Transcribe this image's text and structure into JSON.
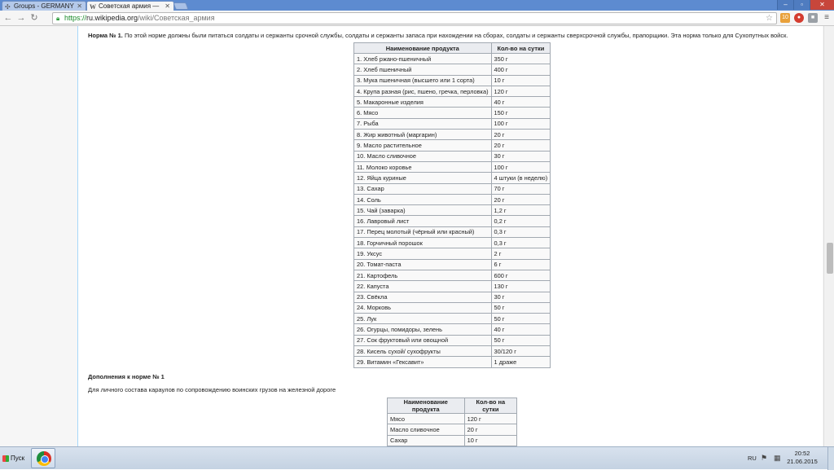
{
  "browser": {
    "tabs": [
      {
        "label": "Groups - GERMANY",
        "icon": "groups-icon",
        "active": false
      },
      {
        "label": "Советская армия —",
        "icon": "wikipedia-icon",
        "active": true
      }
    ],
    "url": {
      "protocol": "https://",
      "host": "ru.wikipedia.org",
      "path": "/wiki/Советская_армия"
    },
    "extension_badge": "10"
  },
  "article": {
    "intro_bold": "Норма № 1.",
    "intro_text": " По этой норме должны были питаться солдаты и сержанты срочной службы, солдаты и сержанты запаса при нахождении на сборах, солдаты и сержанты сверхсрочной службы, прапорщики. Эта норма только для Сухопутных войск.",
    "table1": {
      "headers": [
        "Наименование продукта",
        "Кол-во на сутки"
      ],
      "rows": [
        [
          "1. Хлеб ржано-пшеничный",
          "350 г"
        ],
        [
          "2. Хлеб пшеничный",
          "400 г"
        ],
        [
          "3. Мука пшеничная (высшего или 1 сорта)",
          "10 г"
        ],
        [
          "4. Крупа разная (рис, пшено, гречка, перловка)",
          "120 г"
        ],
        [
          "5. Макаронные изделия",
          "40 г"
        ],
        [
          "6. Мясо",
          "150 г"
        ],
        [
          "7. Рыба",
          "100 г"
        ],
        [
          "8. Жир животный (маргарин)",
          "20 г"
        ],
        [
          "9. Масло растительное",
          "20 г"
        ],
        [
          "10. Масло сливочное",
          "30 г"
        ],
        [
          "11. Молоко коровье",
          "100 г"
        ],
        [
          "12. Яйца куриные",
          "4 штуки (в неделю)"
        ],
        [
          "13. Сахар",
          "70 г"
        ],
        [
          "14. Соль",
          "20 г"
        ],
        [
          "15. Чай (заварка)",
          "1,2 г"
        ],
        [
          "16. Лавровый лист",
          "0,2 г"
        ],
        [
          "17. Перец молотый (чёрный или красный)",
          "0,3 г"
        ],
        [
          "18. Горчичный порошок",
          "0,3 г"
        ],
        [
          "19. Уксус",
          "2 г"
        ],
        [
          "20. Томат-паста",
          "6 г"
        ],
        [
          "21. Картофель",
          "600 г"
        ],
        [
          "22. Капуста",
          "130 г"
        ],
        [
          "23. Свёкла",
          "30 г"
        ],
        [
          "24. Морковь",
          "50 г"
        ],
        [
          "25. Лук",
          "50 г"
        ],
        [
          "26. Огурцы, помидоры, зелень",
          "40 г"
        ],
        [
          "27. Сок фруктовый или овощной",
          "50 г"
        ],
        [
          "28. Кисель сухой/ сухофрукты",
          "30/120 г"
        ],
        [
          "29. Витамин «Гексавит»",
          "1 драже"
        ]
      ]
    },
    "addendum_title": "Дополнения к норме № 1",
    "addendum_text": "Для личного состава караулов по сопровождению воинских грузов на железной дороге",
    "table2": {
      "headers": [
        "Наименование продукта",
        "Кол-во на сутки"
      ],
      "rows": [
        [
          "Мясо",
          "120 г"
        ],
        [
          "Масло сливочное",
          "20 г"
        ],
        [
          "Сахар",
          "10 г"
        ]
      ]
    }
  },
  "taskbar": {
    "start_label": "Пуск",
    "language": "RU",
    "time": "20:52",
    "date": "21.06.2015"
  }
}
